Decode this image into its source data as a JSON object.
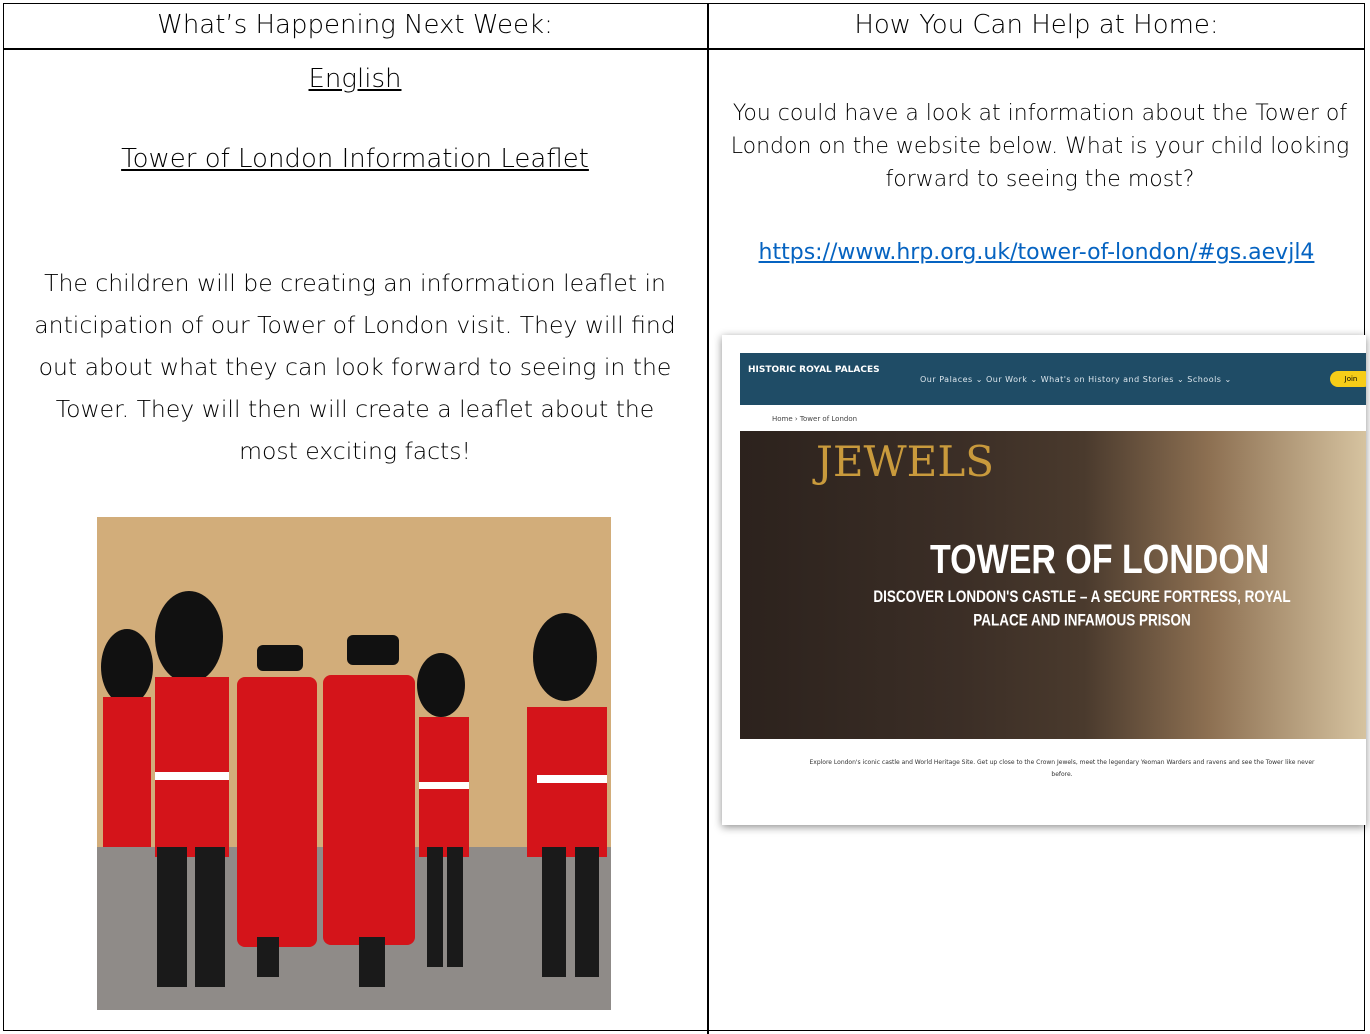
{
  "headers": {
    "left": "What’s Happening Next Week:",
    "right": "How You Can Help at Home:"
  },
  "left": {
    "subject": "English",
    "title": "Tower of London Information Leaflet",
    "description": "The children will be creating an information leaflet in anticipation of our Tower of London visit. They will find out about what they can look forward to seeing in the Tower. They will then will create a leaflet about the most exciting facts!"
  },
  "right": {
    "help_text": "You could have a look at information about the Tower of London on the website below. What is your child looking forward to seeing the most?",
    "link": "https://www.hrp.org.uk/tower-of-london/#gs.aevjl4"
  },
  "website_screenshot": {
    "logo": "HISTORIC ROYAL PALACES",
    "menu": "Our Palaces ⌄   Our Work ⌄   What's on   History and Stories ⌄   Schools ⌄",
    "button": "Join",
    "breadcrumb": "Home  ›  Tower of London",
    "banner_word": "JEWELS",
    "hero_title": "TOWER OF LONDON",
    "hero_subtitle": "DISCOVER LONDON'S CASTLE – A SECURE FORTRESS, ROYAL PALACE AND INFAMOUS PRISON",
    "body": "Explore London's iconic castle and World Heritage Site. Get up close to the Crown Jewels, meet the legendary Yeoman Warders and ravens and see the Tower like never before."
  }
}
